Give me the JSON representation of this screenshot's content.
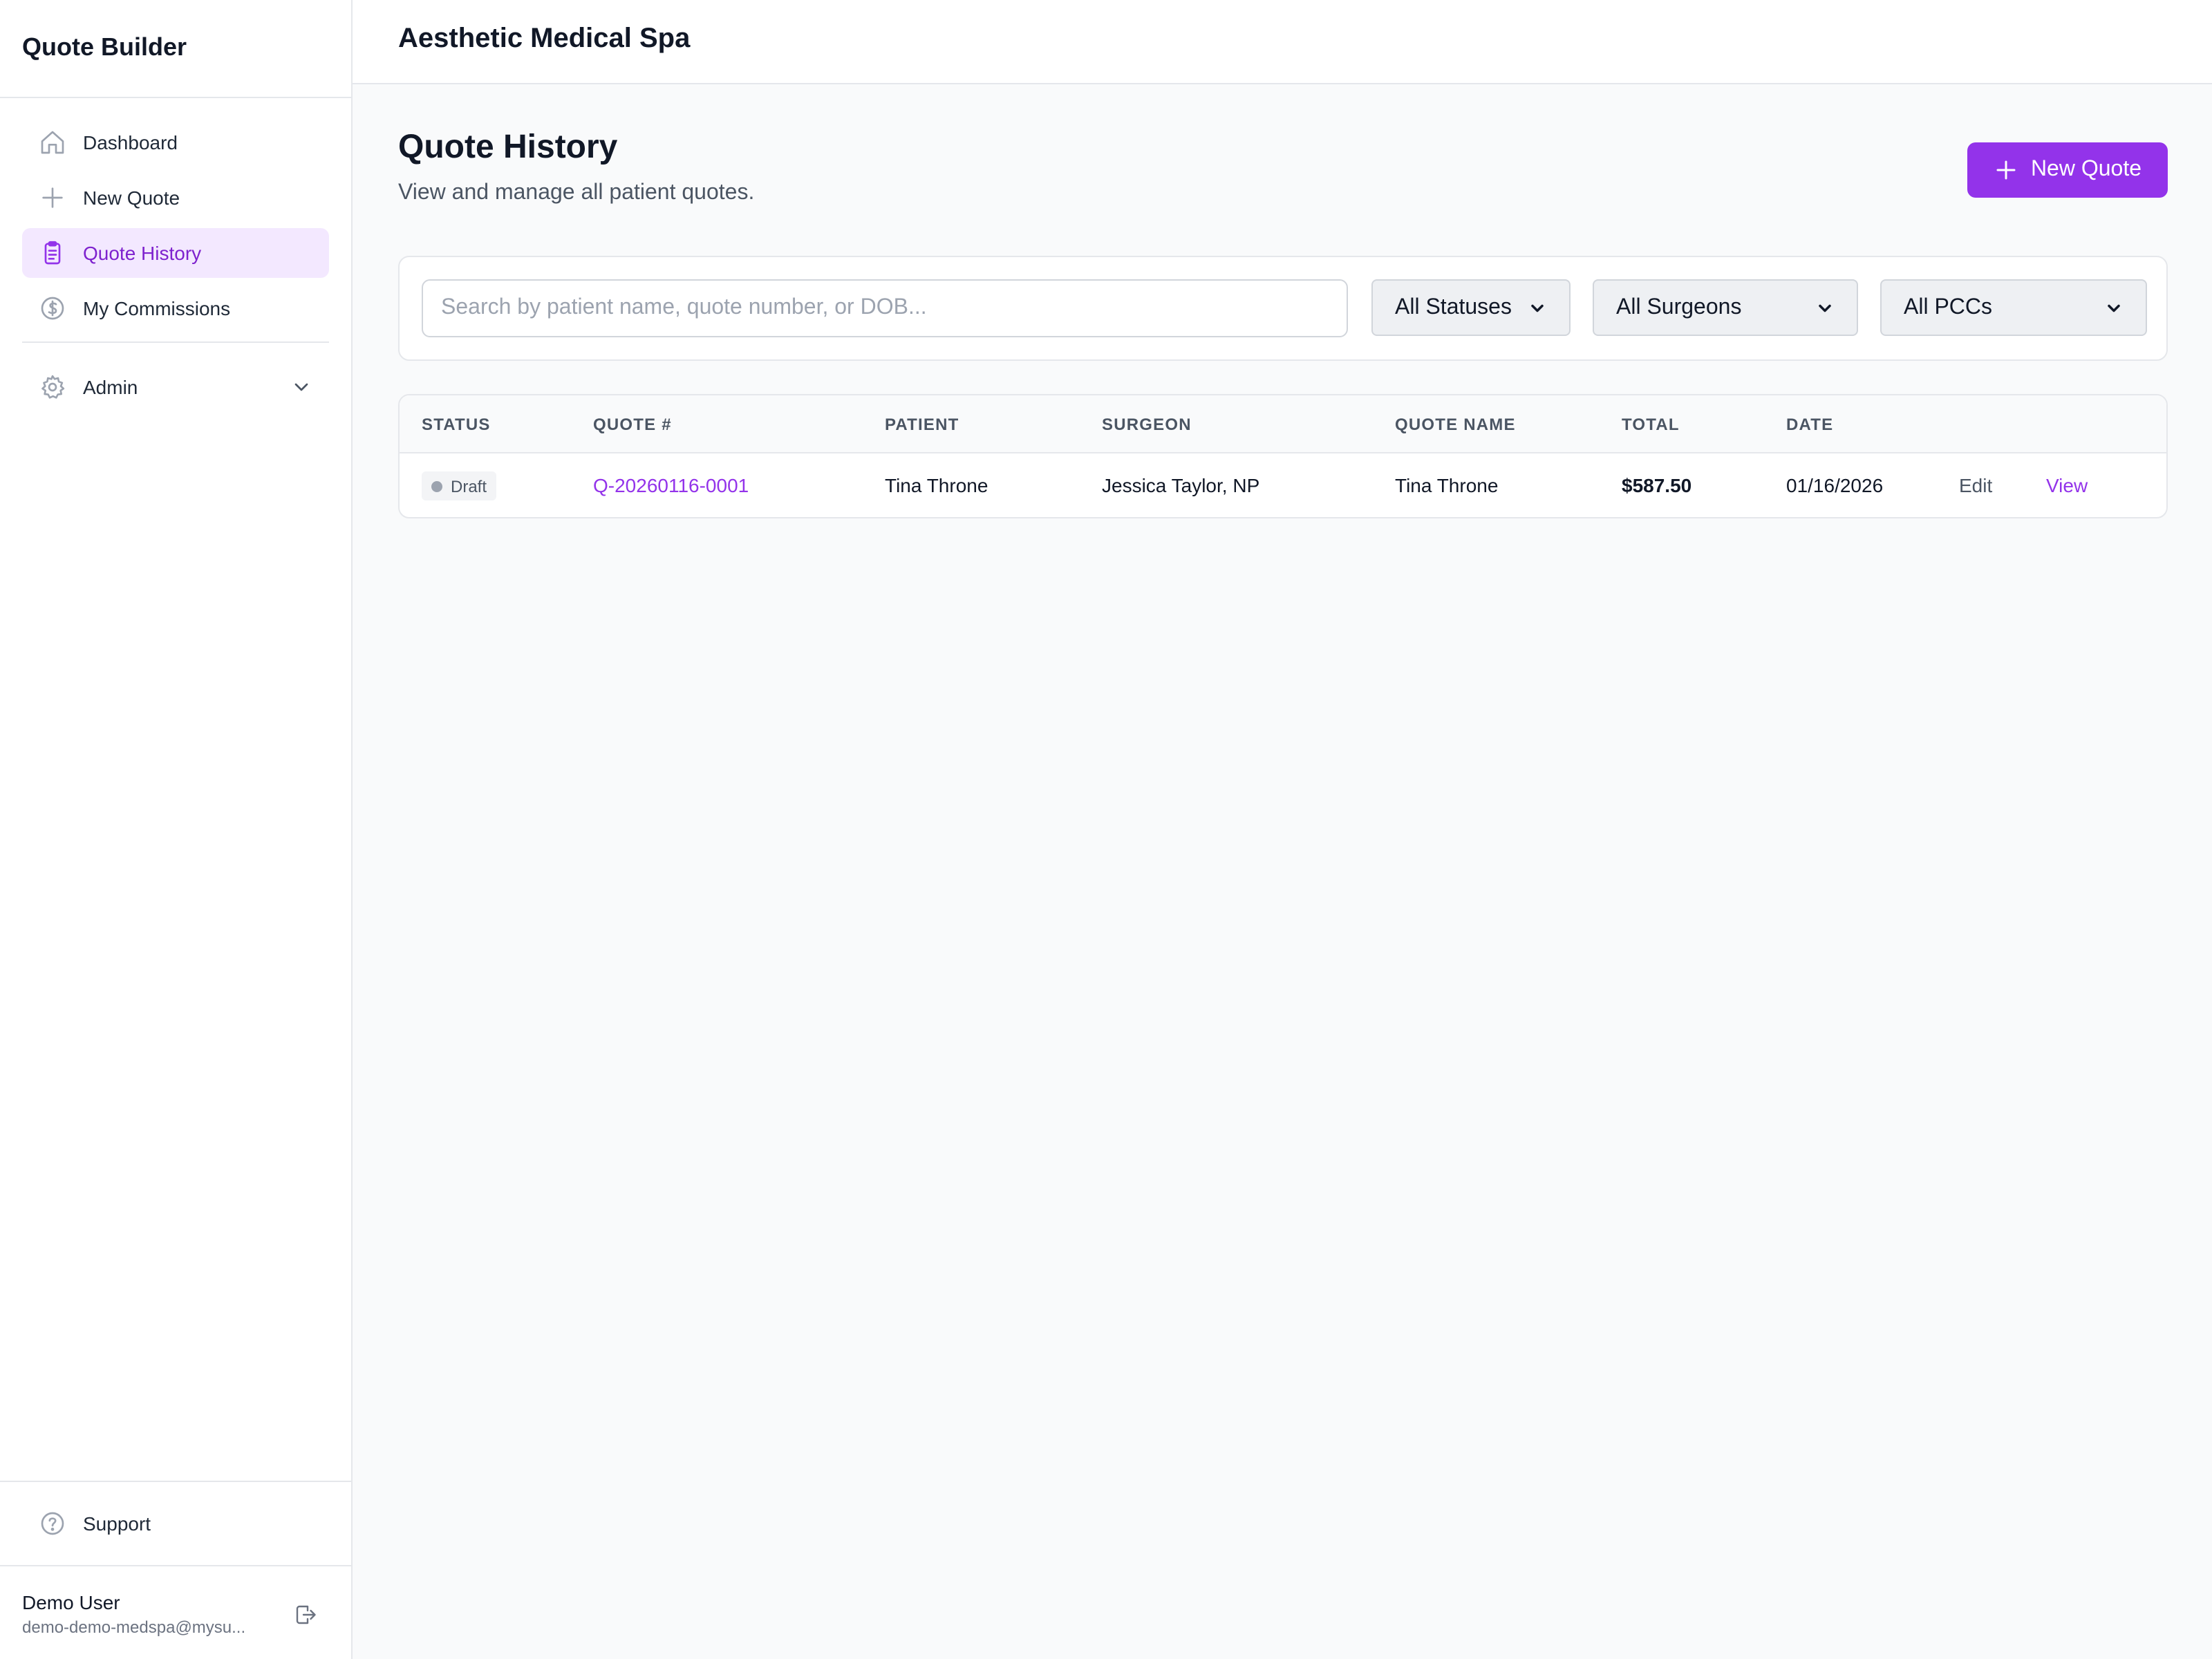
{
  "app": {
    "name": "Quote Builder"
  },
  "sidebar": {
    "items": [
      {
        "label": "Dashboard",
        "icon": "home-icon"
      },
      {
        "label": "New Quote",
        "icon": "plus-icon"
      },
      {
        "label": "Quote History",
        "icon": "clipboard-icon",
        "active": true
      },
      {
        "label": "My Commissions",
        "icon": "dollar-circle-icon"
      }
    ],
    "admin": {
      "label": "Admin",
      "icon": "gear-icon"
    },
    "support": {
      "label": "Support",
      "icon": "help-circle-icon"
    },
    "user": {
      "name": "Demo User",
      "email": "demo-demo-medspa@mysu..."
    }
  },
  "header": {
    "org_name": "Aesthetic Medical Spa"
  },
  "page": {
    "title": "Quote History",
    "subtitle": "View and manage all patient quotes.",
    "new_quote_label": "New Quote"
  },
  "filters": {
    "search_placeholder": "Search by patient name, quote number, or DOB...",
    "status_selected": "All Statuses",
    "surgeon_selected": "All Surgeons",
    "pcc_selected": "All PCCs"
  },
  "table": {
    "columns": [
      "STATUS",
      "QUOTE #",
      "PATIENT",
      "SURGEON",
      "QUOTE NAME",
      "TOTAL",
      "DATE"
    ],
    "rows": [
      {
        "status": "Draft",
        "quote_number": "Q-20260116-0001",
        "patient": "Tina Throne",
        "surgeon": "Jessica Taylor, NP",
        "quote_name": "Tina Throne",
        "total": "$587.50",
        "date": "01/16/2026",
        "edit_label": "Edit",
        "view_label": "View"
      }
    ]
  },
  "colors": {
    "accent": "#9333ea",
    "active_bg": "#f3e8ff",
    "border": "#e5e7eb",
    "page_bg": "#f9fafb"
  }
}
